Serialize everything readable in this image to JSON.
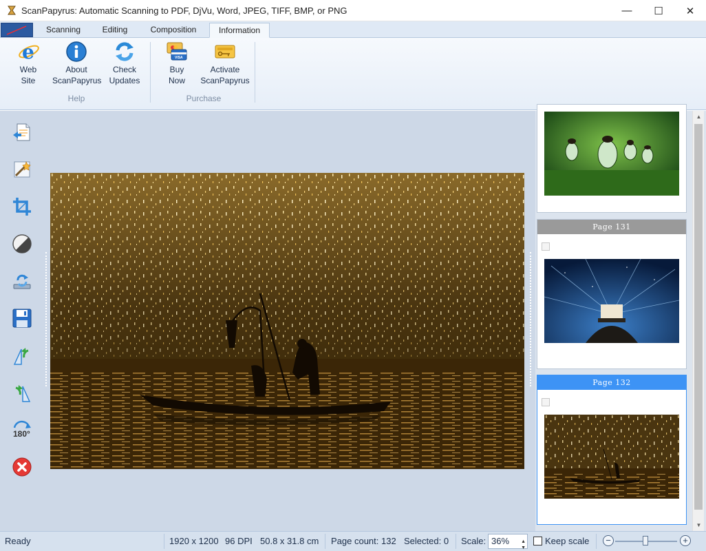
{
  "window": {
    "title": "ScanPapyrus: Automatic Scanning to PDF, DjVu, Word, JPEG, TIFF, BMP, or PNG",
    "controls": {
      "minimize": "—",
      "maximize": "☐",
      "close": "✕"
    }
  },
  "ribbon": {
    "tabs": [
      {
        "label": "Scanning",
        "active": false
      },
      {
        "label": "Editing",
        "active": false
      },
      {
        "label": "Composition",
        "active": false
      },
      {
        "label": "Information",
        "active": true
      }
    ],
    "groups": [
      {
        "label": "Help",
        "buttons": [
          {
            "label": "Web\nSite",
            "icon": "internet-explorer-icon"
          },
          {
            "label": "About\nScanPapyrus",
            "icon": "info-icon"
          },
          {
            "label": "Check\nUpdates",
            "icon": "refresh-icon"
          }
        ]
      },
      {
        "label": "Purchase",
        "buttons": [
          {
            "label": "Buy\nNow",
            "icon": "credit-cards-icon"
          },
          {
            "label": "Activate\nScanPapyrus",
            "icon": "license-key-icon"
          }
        ]
      }
    ]
  },
  "left_toolbar": [
    "import-document-icon",
    "wand-edit-icon",
    "crop-icon",
    "contrast-icon",
    "rescan-icon",
    "save-icon",
    "rotate-left-icon",
    "rotate-right-icon",
    "rotate-180-icon",
    "delete-icon"
  ],
  "thumbnails": [
    {
      "page_label": "",
      "selected": false,
      "image": "water-droplets-on-moss"
    },
    {
      "page_label": "Page 131",
      "selected": false,
      "image": "lighthouse-under-milky-way"
    },
    {
      "page_label": "Page 132",
      "selected": true,
      "image": "fisherman-in-boat-under-sparks"
    }
  ],
  "status": {
    "state": "Ready",
    "resolution": "1920 x 1200",
    "dpi": "96 DPI",
    "size": "50.8 x 31.8 cm",
    "page_count": "Page count: 132",
    "selected": "Selected: 0",
    "scale_label": "Scale:",
    "scale_value": "36%",
    "keep_scale": "Keep scale",
    "zoom_out": "−",
    "zoom_in": "+"
  },
  "colors": {
    "ribbon_bg": "#e6eef8",
    "canvas_bg": "#cdd8e7",
    "selected_header": "#3d93f5",
    "page_header": "#999999"
  }
}
